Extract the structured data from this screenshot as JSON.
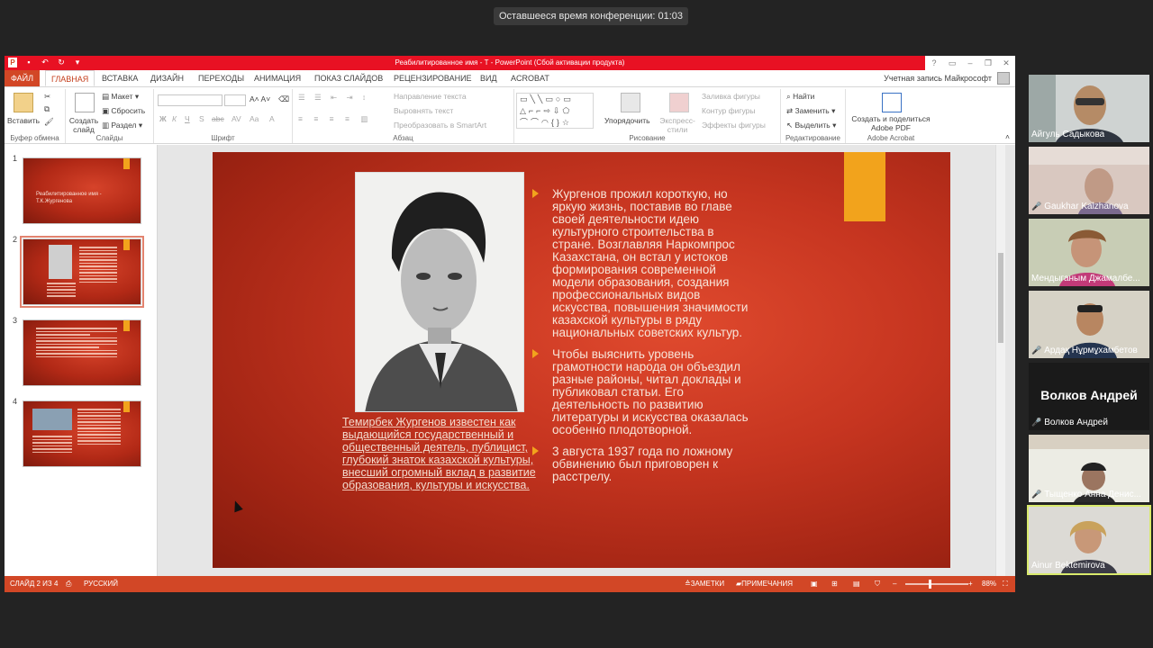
{
  "conference": {
    "timer_text": "Оставшееся время конференции: 01:03"
  },
  "window": {
    "title": "Реабилитированное имя - Т  -  PowerPoint (Сбой активации продукта)",
    "qat_icons": [
      "save-icon",
      "undo-icon",
      "redo-icon",
      "customize-icon"
    ]
  },
  "tabs": {
    "file": "ФАЙЛ",
    "items": [
      "ГЛАВНАЯ",
      "ВСТАВКА",
      "ДИЗАЙН",
      "ПЕРЕХОДЫ",
      "АНИМАЦИЯ",
      "ПОКАЗ СЛАЙДОВ",
      "РЕЦЕНЗИРОВАНИЕ",
      "ВИД",
      "ACROBAT"
    ],
    "account": "Учетная запись Майкрософт"
  },
  "ribbon": {
    "clipboard": {
      "paste": "Вставить",
      "label": "Буфер обмена"
    },
    "slides": {
      "new_slide": "Создать слайд",
      "layout": "Макет",
      "reset": "Сбросить",
      "section": "Раздел",
      "label": "Слайды"
    },
    "font": {
      "bold": "Ж",
      "italic": "К",
      "underline": "Ч",
      "shadow": "S",
      "strike": "abc",
      "label": "Шрифт"
    },
    "paragraph": {
      "text_direction": "Направление текста",
      "align_text": "Выровнять текст",
      "smartart": "Преобразовать в SmartArt",
      "label": "Абзац"
    },
    "drawing": {
      "arrange": "Упорядочить",
      "quick_styles": "Экспресс-стили",
      "fill": "Заливка фигуры",
      "outline": "Контур фигуры",
      "effects": "Эффекты фигуры",
      "label": "Рисование"
    },
    "editing": {
      "find": "Найти",
      "replace": "Заменить",
      "select": "Выделить",
      "label": "Редактирование"
    },
    "acrobat": {
      "create": "Создать и поделиться Adobe PDF",
      "label": "Adobe Acrobat"
    }
  },
  "thumbnails": [
    {
      "num": "1",
      "title": "Реабилитированное имя - Т.К.Жургенова"
    },
    {
      "num": "2"
    },
    {
      "num": "3"
    },
    {
      "num": "4"
    }
  ],
  "slide": {
    "caption": "Темирбек Жургенов известен как выдающийся государственный и общественный деятель, публицист, глубокий знаток казахской культуры, внесший огромный вклад в развитие образования, культуры и искусства.",
    "bullet1": "Жургенов прожил короткую, но яркую жизнь, поставив во главе своей деятельности идею культурного строительства в стране. Возглавляя Наркомпрос Казахстана, он встал у истоков формирования современной модели образования, создания профессиональных видов искусства, повышения значимости казахской культуры в ряду национальных советских культур.",
    "bullet2": " Чтобы выяснить уровень грамотности народа он объездил разные районы, читал доклады и публиковал статьи. Его деятельность по развитию литературы и искусства оказалась особенно плодотворной.",
    "bullet3": "3 августа 1937 года по ложному обвинению был приговорен к расстрелу."
  },
  "statusbar": {
    "slide_info": "СЛАЙД 2 ИЗ 4",
    "language": "РУССКИЙ",
    "notes": "ЗАМЕТКИ",
    "comments": "ПРИМЕЧАНИЯ",
    "zoom": "88%"
  },
  "participants": [
    {
      "name": "Айгуль Садыкова",
      "muted": false
    },
    {
      "name": "Gaukhar Kalzhanova",
      "muted": true
    },
    {
      "name": "Мендыганым Джамалбе...",
      "muted": false
    },
    {
      "name": "Ардақ Нұрмұхамбетов",
      "muted": true
    },
    {
      "name": "Волков Андрей",
      "muted": true,
      "no_video": true
    },
    {
      "name": "Тыщенко Анна Денис...",
      "muted": true
    },
    {
      "name": "Ainur Bektemirova",
      "muted": false,
      "active_speaker": true
    }
  ]
}
